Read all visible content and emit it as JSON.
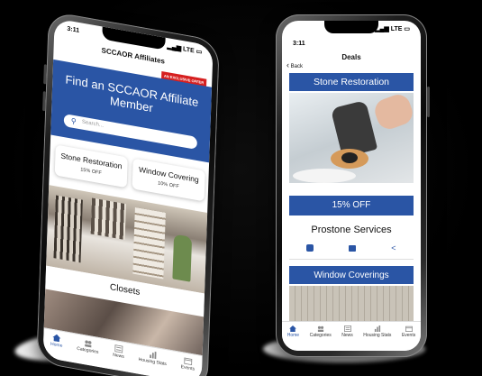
{
  "left_phone": {
    "status": {
      "time": "3:11",
      "network": "LTE"
    },
    "header_title": "SCCAOR Affiliates",
    "badge_text": "AN EXCLUSIVE OFFER",
    "hero_title": "Find an SCCAOR Affiliate Member",
    "search_placeholder": "Search...",
    "deals": [
      {
        "label": "Stone Restoration",
        "discount": "15% OFF"
      },
      {
        "label": "Window Covering",
        "discount": "10% OFF"
      }
    ],
    "category_label": "Closets",
    "tabs": [
      "Home",
      "Categories",
      "News",
      "Housing Stats",
      "Events"
    ]
  },
  "right_phone": {
    "status": {
      "time": "3:11",
      "network": "LTE"
    },
    "back_label": "Back",
    "header_title": "Deals",
    "deal_title": "Stone Restoration",
    "deal_discount": "15% OFF",
    "vendor_name": "Prostone Services",
    "next_section": "Window Coverings",
    "tabs": [
      "Home",
      "Categories",
      "News",
      "Housing Stats",
      "Events"
    ]
  },
  "colors": {
    "brand_blue": "#2a55a5",
    "badge_red": "#d62020"
  }
}
